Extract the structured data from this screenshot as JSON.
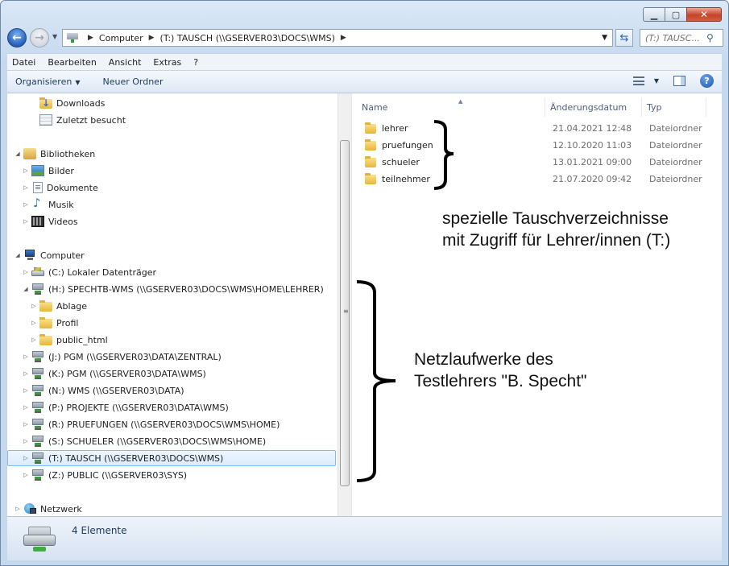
{
  "address": {
    "crumbs": [
      "Computer",
      "(T:) TAUSCH (\\\\GSERVER03\\DOCS\\WMS)"
    ]
  },
  "search": {
    "placeholder": "(T:) TAUSC..."
  },
  "menu": [
    "Datei",
    "Bearbeiten",
    "Ansicht",
    "Extras",
    "?"
  ],
  "toolbar": {
    "organize": "Organisieren",
    "new_folder": "Neuer Ordner"
  },
  "nav": [
    {
      "label": "Downloads",
      "icon": "downloads-folder-icon",
      "expander": ""
    },
    {
      "label": "Zuletzt besucht",
      "icon": "recent-places-icon",
      "expander": ""
    },
    {
      "label": "Bibliotheken",
      "icon": "libraries-icon",
      "expander": "◢"
    },
    {
      "label": "Bilder",
      "icon": "pictures-icon",
      "expander": "▷"
    },
    {
      "label": "Dokumente",
      "icon": "documents-icon",
      "expander": "▷"
    },
    {
      "label": "Musik",
      "icon": "music-icon",
      "expander": "▷"
    },
    {
      "label": "Videos",
      "icon": "videos-icon",
      "expander": "▷"
    },
    {
      "label": "Computer",
      "icon": "computer-icon",
      "expander": "◢"
    },
    {
      "label": "(C:) Lokaler Datenträger",
      "icon": "local-disk-icon",
      "expander": "▷"
    },
    {
      "label": "(H:) SPECHTB-WMS (\\\\GSERVER03\\DOCS\\WMS\\HOME\\LEHRER)",
      "icon": "network-drive-icon",
      "expander": "◢"
    },
    {
      "label": "Ablage",
      "icon": "folder-icon",
      "expander": "▷"
    },
    {
      "label": "Profil",
      "icon": "folder-icon",
      "expander": "▷"
    },
    {
      "label": "public_html",
      "icon": "folder-icon",
      "expander": "▷"
    },
    {
      "label": "(J:) PGM (\\\\GSERVER03\\DATA\\ZENTRAL)",
      "icon": "network-drive-icon",
      "expander": "▷"
    },
    {
      "label": "(K:) PGM (\\\\GSERVER03\\DATA\\WMS)",
      "icon": "network-drive-icon",
      "expander": "▷"
    },
    {
      "label": "(N:) WMS (\\\\GSERVER03\\DATA)",
      "icon": "network-drive-icon",
      "expander": "▷"
    },
    {
      "label": "(P:) PROJEKTE (\\\\GSERVER03\\DATA\\WMS)",
      "icon": "network-drive-icon",
      "expander": "▷"
    },
    {
      "label": "(R:) PRUEFUNGEN (\\\\GSERVER03\\DOCS\\WMS\\HOME)",
      "icon": "network-drive-icon",
      "expander": "▷"
    },
    {
      "label": "(S:) SCHUELER (\\\\GSERVER03\\DOCS\\WMS\\HOME)",
      "icon": "network-drive-icon",
      "expander": "▷"
    },
    {
      "label": "(T:) TAUSCH (\\\\GSERVER03\\DOCS\\WMS)",
      "icon": "network-drive-icon",
      "expander": "▷",
      "selected": true
    },
    {
      "label": "(Z:) PUBLIC (\\\\GSERVER03\\SYS)",
      "icon": "network-drive-icon",
      "expander": "▷"
    },
    {
      "label": "Netzwerk",
      "icon": "network-icon",
      "expander": "▷"
    }
  ],
  "columns": {
    "name": "Name",
    "date": "Änderungsdatum",
    "type": "Typ"
  },
  "files": [
    {
      "name": "lehrer",
      "date": "21.04.2021 12:48",
      "type": "Dateiordner"
    },
    {
      "name": "pruefungen",
      "date": "12.10.2020 11:03",
      "type": "Dateiordner"
    },
    {
      "name": "schueler",
      "date": "13.01.2021 09:00",
      "type": "Dateiordner"
    },
    {
      "name": "teilnehmer",
      "date": "21.07.2020 09:42",
      "type": "Dateiordner"
    }
  ],
  "annotations": {
    "special": [
      "spezielle Tauschverzeichnisse",
      "mit Zugriff für Lehrer/innen (T:)"
    ],
    "drives": [
      "Netzlaufwerke des",
      "Testlehrers \"B. Specht\""
    ]
  },
  "status": {
    "count": "4 Elemente"
  }
}
